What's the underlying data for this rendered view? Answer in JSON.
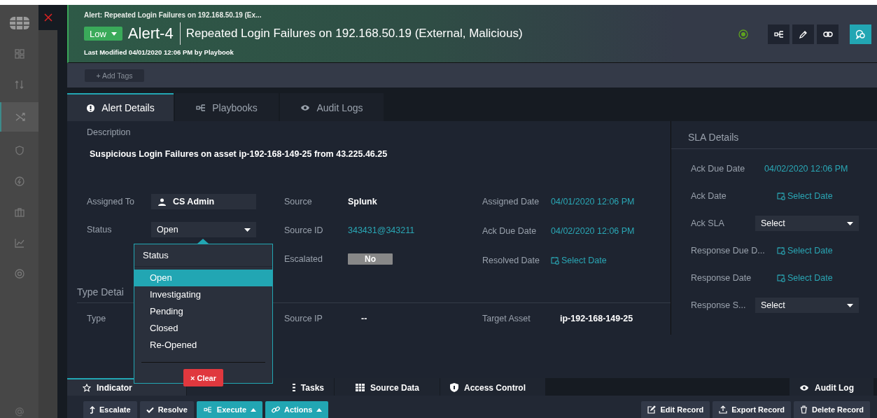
{
  "header": {
    "breadcrumb": "Alert: Repeated Login Failures on 192.168.50.19 (Ex...",
    "severity": "Low",
    "id": "Alert-4",
    "title": "Repeated Login Failures on 192.168.50.19 (External, Malicious)",
    "modified": "Last Modified 04/01/2020 12:06 PM by Playbook"
  },
  "add_tags_button": "+ Add Tags",
  "tabs": [
    {
      "label": "Alert Details",
      "selected": true
    },
    {
      "label": "Playbooks",
      "selected": false
    },
    {
      "label": "Audit Logs",
      "selected": false
    }
  ],
  "description": {
    "label": "Description",
    "text": "Suspicious Login Failures on asset ip-192-168-149-25 from 43.225.46.25"
  },
  "field_columns": [
    [
      {
        "label": "Assigned To",
        "kind": "user",
        "value": "CS Admin"
      },
      {
        "label": "Status",
        "kind": "select",
        "value": "Open"
      }
    ],
    [
      {
        "label": "Source",
        "kind": "text",
        "value": "Splunk"
      },
      {
        "label": "Source ID",
        "kind": "link",
        "value": "343431@343211"
      },
      {
        "label": "Escalated",
        "kind": "toggle",
        "value": "No",
        "on": false
      }
    ],
    [
      {
        "label": "Assigned Date",
        "kind": "link",
        "value": "04/01/2020 12:06 PM"
      },
      {
        "label": "Ack Due Date",
        "kind": "link",
        "value": "04/02/2020 12:06 PM"
      },
      {
        "label": "Resolved Date",
        "kind": "date",
        "value": "Select Date"
      }
    ]
  ],
  "type_details": {
    "heading": "Type Detai",
    "fields": [
      {
        "label": "Type",
        "kind": "empty"
      },
      {
        "label": "Source IP",
        "kind": "text",
        "value": "--"
      },
      {
        "label": "Target Asset",
        "kind": "text",
        "value": "ip-192-168-149-25"
      }
    ]
  },
  "sla": {
    "heading": "SLA Details",
    "fields": [
      {
        "label": "Ack Due Date",
        "kind": "link",
        "value": "04/02/2020 12:06 PM"
      },
      {
        "label": "Ack Date",
        "kind": "date",
        "value": "Select Date"
      },
      {
        "label": "Ack SLA",
        "kind": "select",
        "value": "Select"
      },
      {
        "label": "Response Due D...",
        "kind": "date",
        "value": "Select Date"
      },
      {
        "label": "Response Date",
        "kind": "date",
        "value": "Select Date"
      },
      {
        "label": "Response S...",
        "kind": "select",
        "value": "Select"
      }
    ]
  },
  "status_menu": {
    "heading": "Status",
    "options": [
      {
        "label": "Open",
        "selected": true
      },
      {
        "label": "Investigating",
        "selected": false
      },
      {
        "label": "Pending",
        "selected": false
      },
      {
        "label": "Closed",
        "selected": false
      },
      {
        "label": "Re-Opened",
        "selected": false
      }
    ],
    "clear_button": "× Clear"
  },
  "bottom_tabs": [
    {
      "label": "Indicator",
      "selected": true
    },
    {
      "label": "Tasks",
      "selected": false
    },
    {
      "label": "Source Data",
      "selected": false
    },
    {
      "label": "Access Control",
      "selected": false
    }
  ],
  "audit_log_tab": "Audit Log",
  "actions": [
    {
      "label": "Escalate",
      "kind": "plain"
    },
    {
      "label": "Resolve",
      "kind": "plain"
    },
    {
      "label": "Execute",
      "kind": "menu"
    },
    {
      "label": "Actions",
      "kind": "menu"
    }
  ],
  "record_actions": [
    "Edit Record",
    "Export Record",
    "Delete Record"
  ]
}
